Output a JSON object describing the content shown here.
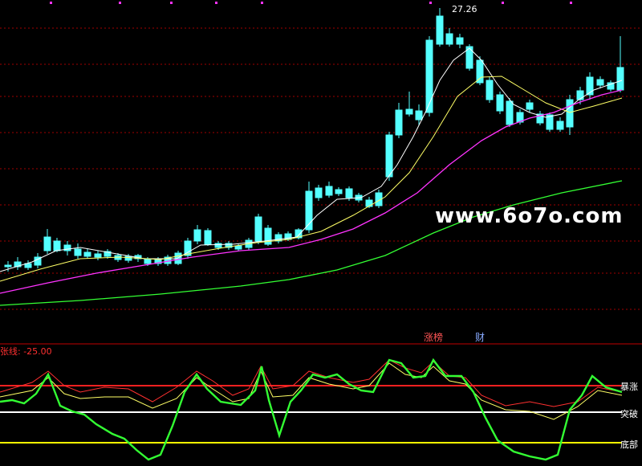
{
  "price_panel": {
    "peak_label": "27.26"
  },
  "watermark": "www.6o7o.com",
  "tags": {
    "limit_up_list": "涨榜",
    "finance": "财"
  },
  "indicator_panel": {
    "title": "张线: -25.00",
    "level_labels": {
      "surge": "暴涨",
      "breakout": "突破",
      "bottom": "底部"
    }
  },
  "colors": {
    "background": "#000000",
    "up_candle": "#ff3b3b",
    "down_candle": "#54ffff",
    "ma_white": "#ffffff",
    "ma_yellow": "#ffff66",
    "ma_magenta": "#ff33ff",
    "ma_green": "#33ff33",
    "grid": "#a00000",
    "level_surge": "#ff2020",
    "level_breakout": "#ffffff",
    "level_bottom": "#ffff00",
    "osc_green": "#33ff33",
    "osc_red": "#ff3030",
    "osc_yellow": "#ffff66",
    "title_red": "#ff3030",
    "tag_red": "#ff5555",
    "tag_blue": "#88aaff"
  }
}
